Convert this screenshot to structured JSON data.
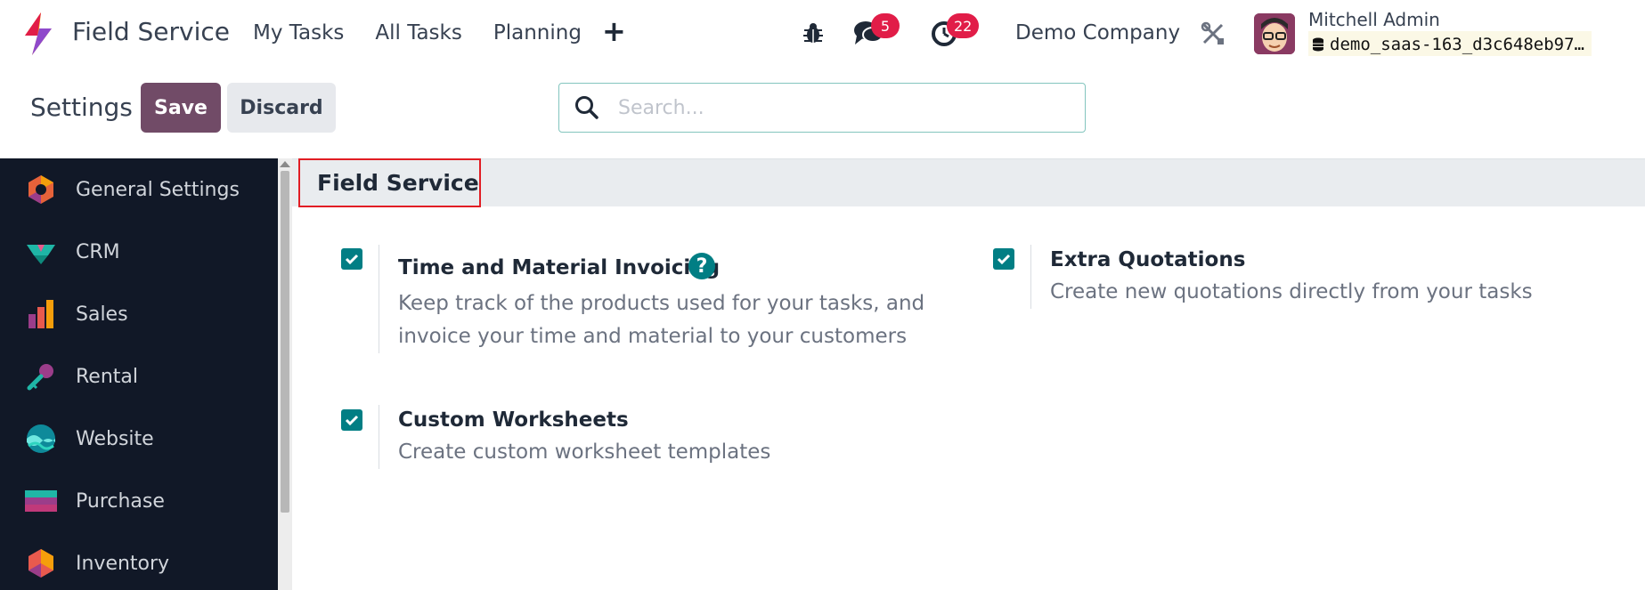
{
  "navbar": {
    "app_name": "Field Service",
    "menu": [
      "My Tasks",
      "All Tasks",
      "Planning"
    ],
    "plus_label": "+",
    "messages_count": "5",
    "activities_count": "22",
    "company": "Demo Company",
    "user_name": "Mitchell Admin",
    "database": "demo_saas-163_d3c648eb97…"
  },
  "control_panel": {
    "title": "Settings",
    "save_label": "Save",
    "discard_label": "Discard",
    "search_placeholder": "Search..."
  },
  "sidebar": {
    "items": [
      {
        "label": "General Settings",
        "icon": "general-settings-icon"
      },
      {
        "label": "CRM",
        "icon": "crm-icon"
      },
      {
        "label": "Sales",
        "icon": "sales-icon"
      },
      {
        "label": "Rental",
        "icon": "rental-icon"
      },
      {
        "label": "Website",
        "icon": "website-icon"
      },
      {
        "label": "Purchase",
        "icon": "purchase-icon"
      },
      {
        "label": "Inventory",
        "icon": "inventory-icon"
      }
    ]
  },
  "section": {
    "title": "Field Service",
    "settings": [
      {
        "title": "Time and Material Invoicing",
        "description_1": "Keep track of the products used for your tasks, and",
        "description_2": "invoice your time and material to your customers",
        "checked": true
      },
      {
        "title": "Extra Quotations",
        "description": "Create new quotations directly from your tasks",
        "checked": true
      },
      {
        "title": "Custom Worksheets",
        "description": "Create custom worksheet templates",
        "checked": true
      }
    ]
  },
  "colors": {
    "brand": "#714b67",
    "accent": "#017e84",
    "badge": "#e11d48",
    "sidebar_bg": "#111827",
    "highlight_border": "#e11d24"
  }
}
